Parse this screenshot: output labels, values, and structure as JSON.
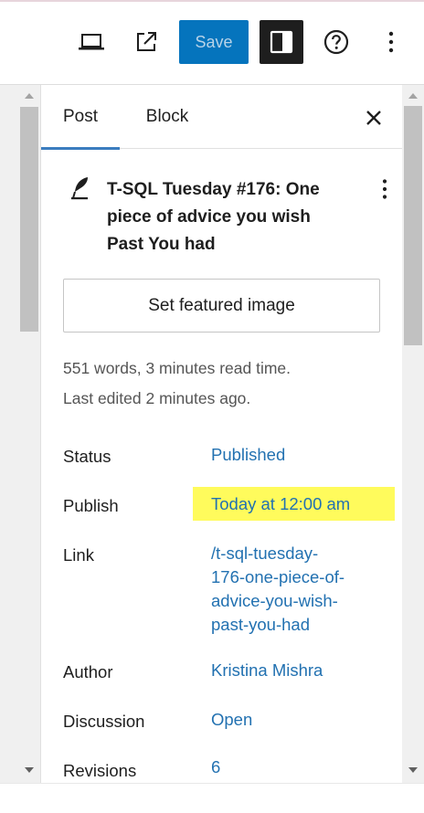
{
  "toolbar": {
    "preview_icon": "laptop-icon",
    "view_post_icon": "external-link-icon",
    "save_label": "Save",
    "settings_icon": "sidebar-panel-icon",
    "help_icon": "help-icon",
    "options_icon": "more-vertical-icon",
    "save_color": "#0574bd"
  },
  "sidebar": {
    "tabs": [
      {
        "label": "Post",
        "active": true
      },
      {
        "label": "Block",
        "active": false
      }
    ],
    "close_icon": "close-icon",
    "post": {
      "icon": "feather-icon",
      "title": "T-SQL Tuesday #176: One piece of advice you wish Past You had",
      "title_lines": [
        "T-SQL Tuesday #176: One",
        "piece of advice you wish",
        "Past You had"
      ],
      "featured_image_label": "Set featured image",
      "word_count_text": "551 words, 3 minutes read time.",
      "last_edited_text": "Last edited 2 minutes ago."
    },
    "summary": [
      {
        "label": "Status",
        "value": "Published"
      },
      {
        "label": "Publish",
        "value": "Today at 12:00 am",
        "highlighted": true
      },
      {
        "label": "Link",
        "value": "/t-sql-tuesday-176-one-piece-of-advice-you-wish-past-you-had",
        "value_lines": [
          "/t-sql-tuesday-",
          "176-one-piece-of-",
          "advice-you-wish-",
          "past-you-had"
        ]
      },
      {
        "label": "Author",
        "value": "Kristina Mishra"
      },
      {
        "label": "Discussion",
        "value": "Open"
      },
      {
        "label": "Revisions",
        "value": "6"
      }
    ],
    "highlight_color": "#fffb5c",
    "link_color": "#2271b1"
  }
}
